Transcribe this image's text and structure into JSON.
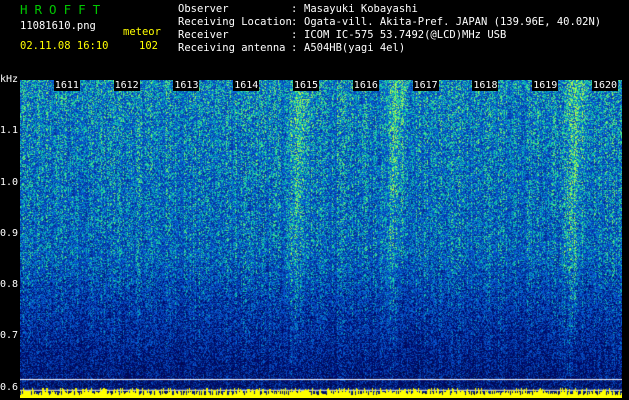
{
  "header": {
    "app_title": "HROFFT",
    "filename": "11081610.png",
    "date_time": "02.11.08 16:10",
    "meteor_label": "meteor",
    "meteor_count": "102",
    "fields": [
      {
        "label": "Observer",
        "value": "Masayuki Kobayashi"
      },
      {
        "label": "Receiving Location",
        "value": "Ogata-vill. Akita-Pref. JAPAN (139.96E, 40.02N)"
      },
      {
        "label": "Receiver",
        "value": "ICOM IC-575 53.7492(@LCD)MHz USB"
      },
      {
        "label": "Receiving antenna",
        "value": "A504HB(yagi 4el)"
      }
    ]
  },
  "colors": {
    "background": "#000000",
    "title": "#00c800",
    "header_text": "#ffff00",
    "label_text": "#ffffff",
    "spectrum_low": "#000a3c",
    "spectrum_mid": "#1e3cdc",
    "spectrum_high": "#30e0a0",
    "spectrum_peak": "#c8ff40",
    "baseline": "#ffff00"
  },
  "chart_data": {
    "type": "heatmap",
    "title": "",
    "ylabel": "kHz",
    "ylim": [
      0.58,
      1.2
    ],
    "y_ticks": [
      "1.1",
      "1.0",
      "0.9",
      "0.8",
      "0.7",
      "0.6"
    ],
    "y_tick_values": [
      1.1,
      1.0,
      0.9,
      0.8,
      0.7,
      0.6
    ],
    "x_ticks": [
      "1611",
      "1612",
      "1613",
      "1614",
      "1615",
      "1616",
      "1617",
      "1618",
      "1619",
      "1620"
    ],
    "x_range": [
      "1610",
      "1620"
    ],
    "meteor_trail_times": [
      1614.6,
      1616.2,
      1619.2
    ],
    "grid": false,
    "legend": "none"
  }
}
